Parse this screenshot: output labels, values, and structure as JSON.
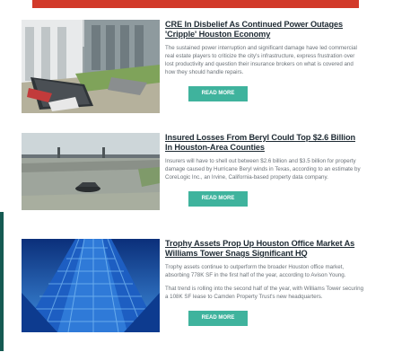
{
  "banner": {
    "label": ""
  },
  "articles": [
    {
      "headline": "CRE In Disbelief As Continued Power Outages 'Cripple' Houston Economy",
      "summary": "The sustained power interruption and significant damage have led commercial real estate players to criticize the city's infrastructure, express frustration over lost productivity and question their insurance brokers on what is covered and how they should handle repairs.",
      "summary2": "",
      "button": "READ MORE",
      "image": "storm-damaged-building-photo"
    },
    {
      "headline": "Insured Losses From Beryl Could Top $2.6 Billion In Houston-Area Counties",
      "summary": "Insurers will have to shell out between $2.6 billion and $3.5 billion for property damage caused by Hurricane Beryl winds in Texas, according to an estimate by CoreLogic Inc., an Irvine, California-based property data company.",
      "summary2": "",
      "button": "READ MORE",
      "image": "flooded-highway-photo"
    },
    {
      "headline": "Trophy Assets Prop Up Houston Office Market As Williams Tower Snags Significant HQ",
      "summary": "Trophy assets continue to outperform the broader Houston office market, absorbing 778K SF in the first half of the year, according to Avison Young.",
      "summary2": "That trend is rolling into the second half of the year, with Williams Tower securing a 108K SF lease to Camden Property Trust's new headquarters.",
      "button": "READ MORE",
      "image": "glass-tower-photo"
    }
  ],
  "colors": {
    "accent": "#3fb39d",
    "banner": "#d23a2a",
    "headline": "#1e2a33"
  }
}
